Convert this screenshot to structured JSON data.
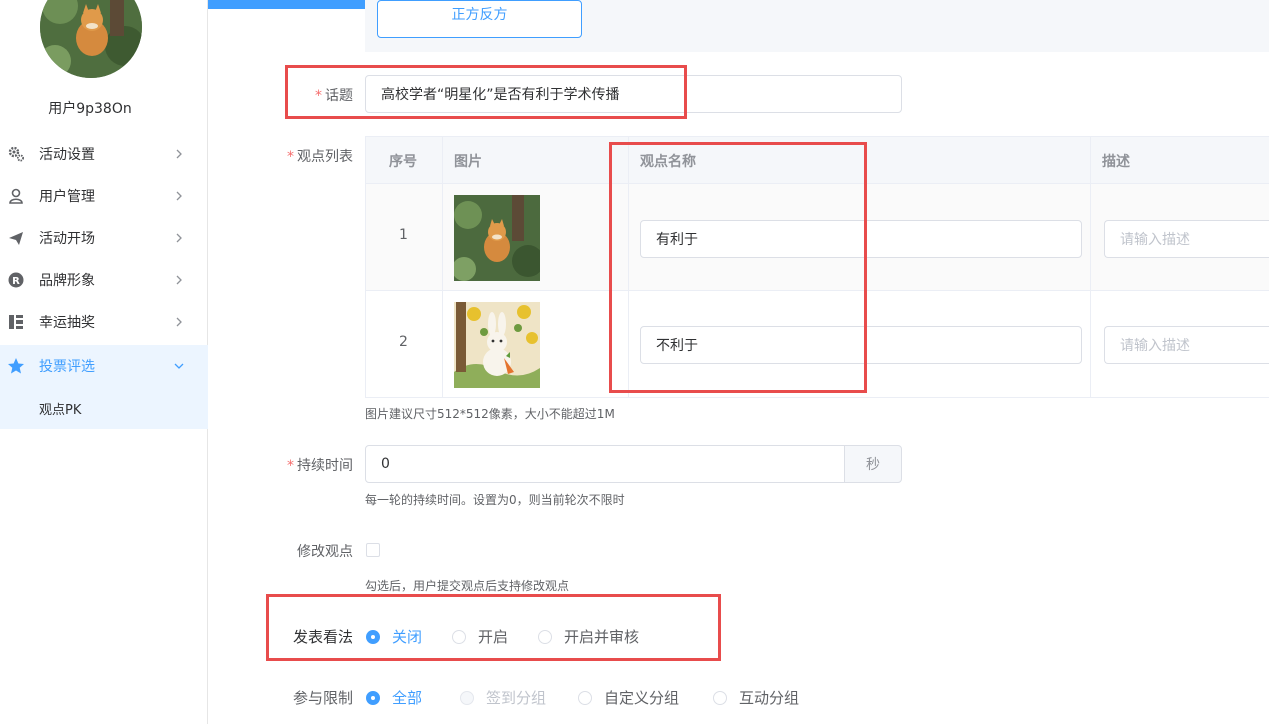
{
  "sidebar": {
    "username": "用户9p38On",
    "items": [
      {
        "label": "活动设置",
        "icon": "gears-icon"
      },
      {
        "label": "用户管理",
        "icon": "user-icon"
      },
      {
        "label": "活动开场",
        "icon": "paper-plane-icon"
      },
      {
        "label": "品牌形象",
        "icon": "registered-icon"
      },
      {
        "label": "幸运抽奖",
        "icon": "lottery-icon"
      },
      {
        "label": "投票评选",
        "icon": "star-icon"
      }
    ],
    "submenu": {
      "label": "观点PK"
    }
  },
  "form": {
    "mode_button": "正方反方",
    "topic": {
      "label": "话题",
      "value": "高校学者“明星化”是否有利于学术传播"
    },
    "views": {
      "label": "观点列表",
      "columns": [
        "序号",
        "图片",
        "观点名称",
        "描述"
      ],
      "rows": [
        {
          "index": "1",
          "image": "cat-photo",
          "name": "有利于",
          "desc_placeholder": "请输入描述"
        },
        {
          "index": "2",
          "image": "rabbit-illustration",
          "name": "不利于",
          "desc_placeholder": "请输入描述"
        }
      ],
      "tip": "图片建议尺寸512*512像素，大小不能超过1M"
    },
    "duration": {
      "label": "持续时间",
      "value": "0",
      "unit": "秒",
      "tip": "每一轮的持续时间。设置为0，则当前轮次不限时"
    },
    "modify_view": {
      "label": "修改观点",
      "checked": false,
      "tip": "勾选后，用户提交观点后支持修改观点"
    },
    "comment": {
      "label": "发表看法",
      "options": [
        "关闭",
        "开启",
        "开启并审核"
      ],
      "selected": "关闭"
    },
    "limit": {
      "label": "参与限制",
      "options": [
        "全部",
        "签到分组",
        "自定义分组",
        "互动分组"
      ],
      "selected": "全部",
      "disabled": "签到分组"
    }
  },
  "colors": {
    "primary": "#409eff",
    "highlight_box": "#e84c4c",
    "required": "#f56c6c"
  }
}
